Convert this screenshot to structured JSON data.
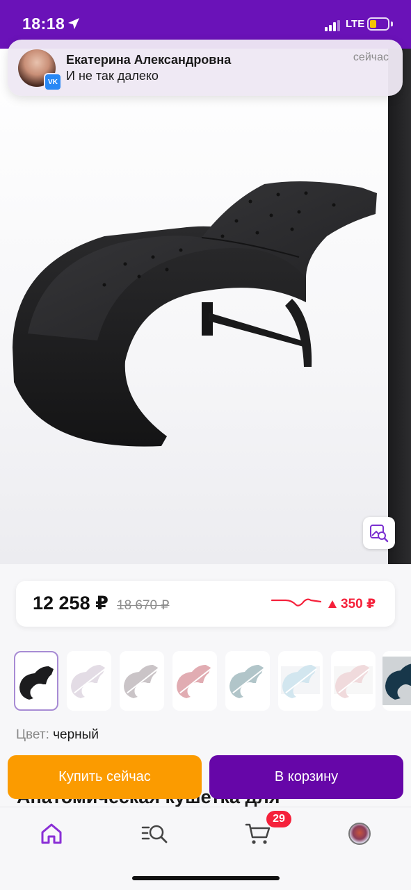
{
  "status_bar": {
    "time": "18:18",
    "network": "LTE"
  },
  "notification": {
    "app_icon": "vk-icon",
    "sender": "Екатерина Александровна",
    "message": "И не так далеко",
    "time": "сейчас"
  },
  "product": {
    "image_description_icon": "search-by-photo-icon",
    "price": {
      "current": "12 258 ₽",
      "old": "18 670 ₽",
      "change": "350 ₽",
      "change_direction": "up",
      "change_color": "#f5213b"
    },
    "thumbnails": [
      {
        "color": "черный",
        "selected": true,
        "available": true,
        "swatch": "#1c1c1e"
      },
      {
        "color": "",
        "selected": false,
        "available": false,
        "swatch": "#b9a8bf"
      },
      {
        "color": "",
        "selected": false,
        "available": false,
        "swatch": "#7b6d73"
      },
      {
        "color": "",
        "selected": false,
        "available": false,
        "swatch": "#b5313f"
      },
      {
        "color": "",
        "selected": false,
        "available": false,
        "swatch": "#3d6f78"
      },
      {
        "color": "",
        "selected": false,
        "available": false,
        "swatch": "#8fc0d6"
      },
      {
        "color": "",
        "selected": false,
        "available": false,
        "swatch": "#d9a3a8"
      },
      {
        "color": "",
        "selected": false,
        "available": true,
        "swatch": "#17374a"
      }
    ],
    "color_label": "Цвет:",
    "color_value": "черный",
    "title_partial": "Анатомическая кушетка для"
  },
  "actions": {
    "buy_now": "Купить сейчас",
    "add_to_cart": "В корзину"
  },
  "tab_bar": {
    "items": [
      {
        "name": "home",
        "icon": "home-icon",
        "active": true
      },
      {
        "name": "catalog",
        "icon": "catalog-search-icon",
        "active": false
      },
      {
        "name": "cart",
        "icon": "cart-icon",
        "active": false
      },
      {
        "name": "profile",
        "icon": "profile-avatar",
        "active": false
      }
    ],
    "cart_badge": "29"
  },
  "colors": {
    "brand_purple": "#6606a8",
    "status_bar_purple": "#6a12b8",
    "buy_orange": "#fb9b00",
    "accent_red": "#f5213b"
  }
}
